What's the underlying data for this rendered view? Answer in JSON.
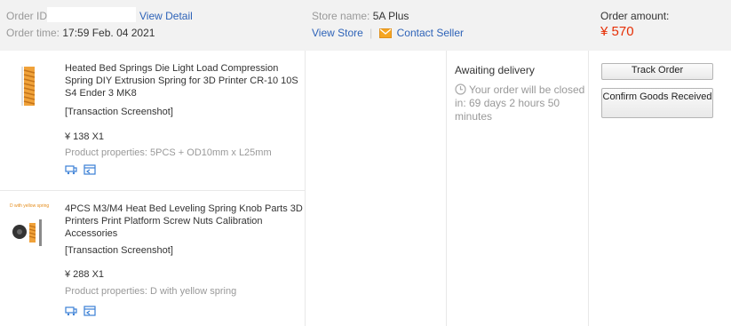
{
  "order": {
    "id_label": "Order ID:",
    "view_detail": "View Detail",
    "time_label": "Order time:",
    "time_value": "17:59 Feb. 04 2021",
    "store_label": "Store name:",
    "store_value": "5A Plus",
    "view_store": "View Store",
    "separator": "|",
    "contact_seller": "Contact Seller",
    "amount_label": "Order amount:",
    "amount_value": "¥ 570"
  },
  "products": [
    {
      "title": "Heated Bed Springs Die Light Load Compression Spring DIY Extrusion Spring for 3D Printer CR-10 10S S4 Ender 3 MK8",
      "screenshot": "[Transaction Screenshot]",
      "price_qty": "¥ 138 X1",
      "properties": "Product properties: 5PCS + OD10mm x L25mm"
    },
    {
      "title": "4PCS M3/M4 Heat Bed Leveling Spring Knob Parts 3D Printers Print Platform Screw Nuts Calibration Accessories",
      "screenshot": "[Transaction Screenshot]",
      "price_qty": "¥ 288 X1",
      "properties": "Product properties: D with yellow spring"
    }
  ],
  "status": {
    "label": "Awaiting delivery",
    "note": "Your order will be closed in: 69 days 2 hours 50 minutes"
  },
  "actions": {
    "track_order": "Track Order",
    "confirm_goods": "Confirm Goods Received"
  },
  "colors": {
    "accent_price": "#e62e04",
    "link": "#2e63b8",
    "header_bg": "#f2f2f2"
  },
  "icons": [
    "mail-icon",
    "clock-icon",
    "cart-icon",
    "snapshot-icon",
    "spring-thumbnail",
    "knob-spring-thumbnail"
  ]
}
